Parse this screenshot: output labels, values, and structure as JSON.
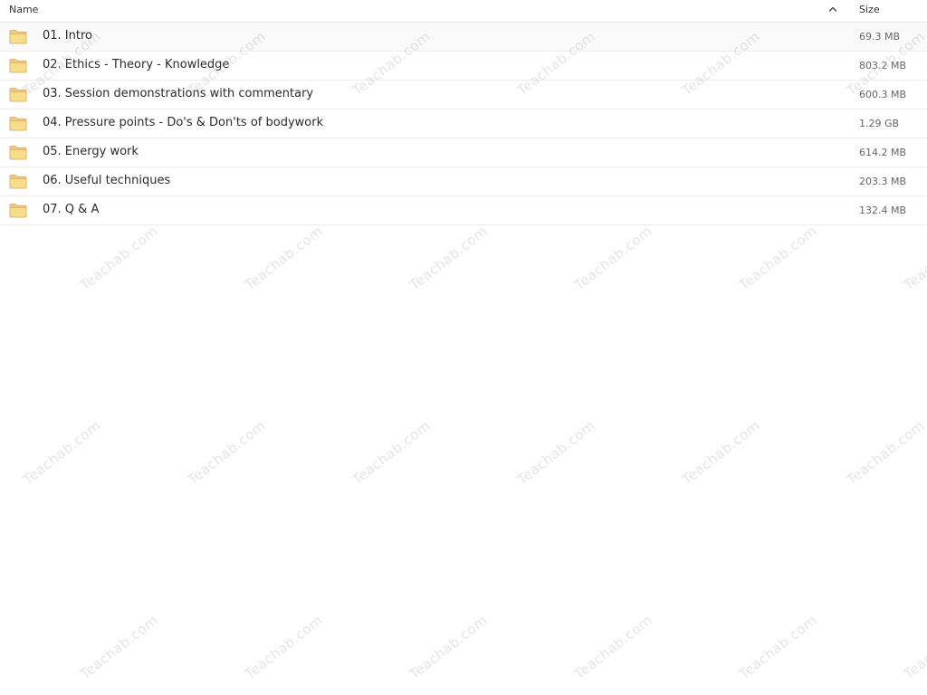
{
  "header": {
    "name_label": "Name",
    "size_label": "Size",
    "sort_icon": "chevron-up-icon"
  },
  "files": [
    {
      "name": "01. Intro",
      "size": "69.3 MB",
      "icon": "folder-icon"
    },
    {
      "name": "02. Ethics - Theory - Knowledge",
      "size": "803.2 MB",
      "icon": "folder-icon"
    },
    {
      "name": "03. Session demonstrations with commentary",
      "size": "600.3 MB",
      "icon": "folder-icon"
    },
    {
      "name": "04. Pressure points - Do's & Don'ts of bodywork",
      "size": "1.29 GB",
      "icon": "folder-icon"
    },
    {
      "name": "05. Energy work",
      "size": "614.2 MB",
      "icon": "folder-icon"
    },
    {
      "name": "06. Useful techniques",
      "size": "203.3 MB",
      "icon": "folder-icon"
    },
    {
      "name": "07. Q & A",
      "size": "132.4 MB",
      "icon": "folder-icon"
    }
  ],
  "watermark": {
    "text": "Teachab.com"
  },
  "colors": {
    "folder_fill": "#f8dd8a",
    "folder_tab": "#f0cc6a",
    "folder_stroke": "#d9b14f",
    "divider": "#ececec"
  }
}
